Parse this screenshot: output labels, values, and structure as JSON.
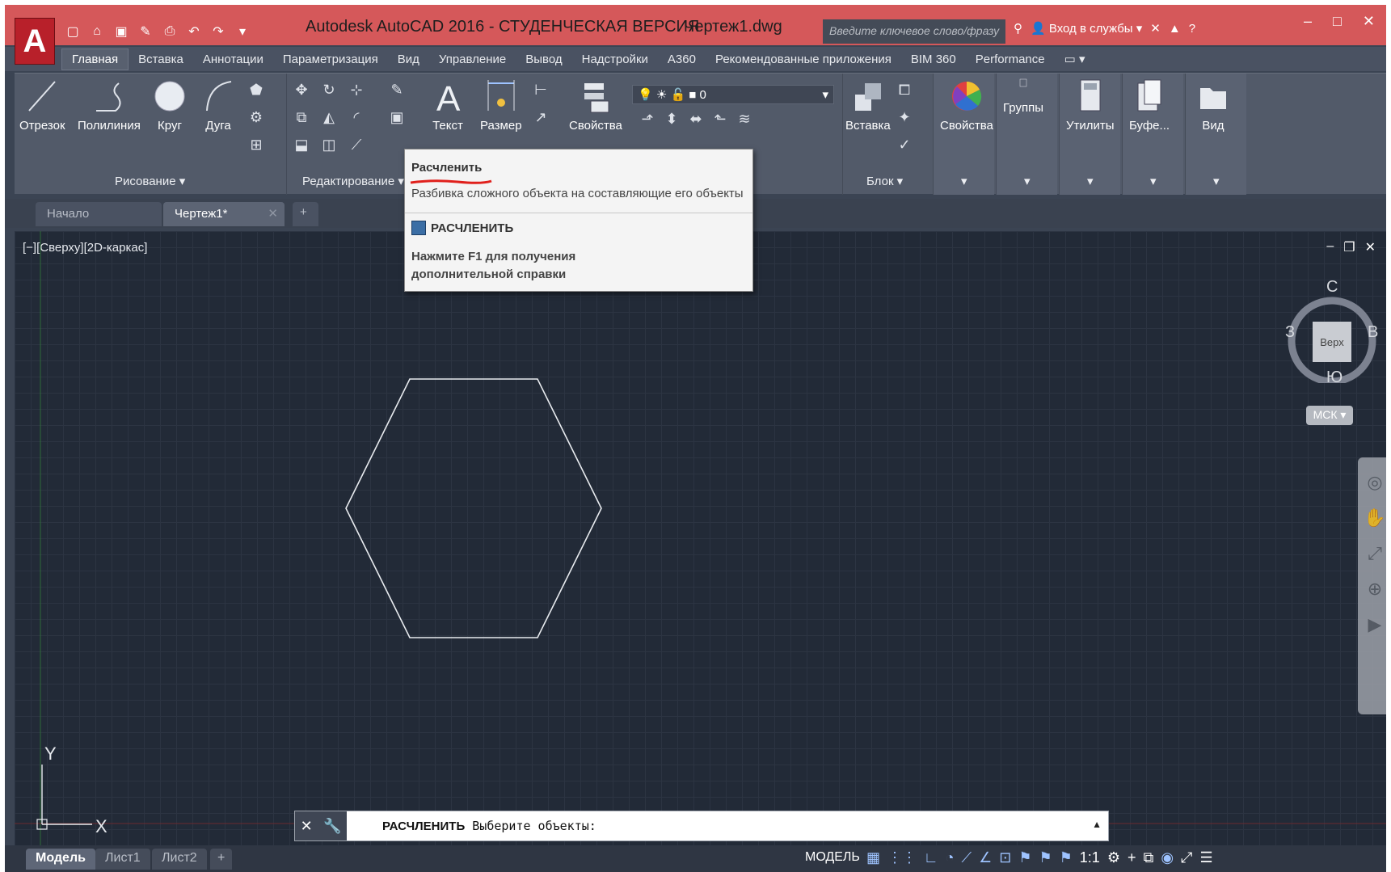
{
  "title": {
    "app": "Autodesk AutoCAD 2016 - СТУДЕНЧЕСКАЯ ВЕРСИЯ",
    "file": "Чертеж1.dwg",
    "search_placeholder": "Введите ключевое слово/фразу",
    "signin": "Вход в службы"
  },
  "ribbon_tabs": [
    "Главная",
    "Вставка",
    "Аннотации",
    "Параметризация",
    "Вид",
    "Управление",
    "Вывод",
    "Надстройки",
    "A360",
    "Рекомендованные приложения",
    "BIM 360",
    "Performance"
  ],
  "draw_tools": [
    "Отрезок",
    "Полилиния",
    "Круг",
    "Дуга"
  ],
  "annotation_tools": [
    "Текст",
    "Размер"
  ],
  "layer_tools": {
    "properties": "Свойства",
    "layer_value": "0"
  },
  "block_tools": {
    "insert": "Вставка"
  },
  "big_buttons": [
    "Свойства",
    "Группы",
    "Утилиты",
    "Буфе...",
    "Вид"
  ],
  "panel_labels": {
    "draw": "Рисование",
    "modify": "Редактирование",
    "block": "Блок"
  },
  "file_tabs": [
    "Начало",
    "Чертеж1*"
  ],
  "viewport_label": "[−][Сверху][2D-каркас]",
  "viewcube": {
    "north": "С",
    "south": "Ю",
    "west": "З",
    "east": "В",
    "face": "Верх",
    "ucs": "МСК"
  },
  "axis": {
    "x": "X",
    "y": "Y"
  },
  "tooltip": {
    "title": "Расчленить",
    "description": "Разбивка сложного объекта на составляющие его объекты",
    "command": "РАСЧЛЕНИТЬ",
    "help_line1": "Нажмите F1 для получения",
    "help_line2": "дополнительной справки"
  },
  "command_line": {
    "command": "РАСЧЛЕНИТЬ",
    "prompt": "Выберите объекты:"
  },
  "layout_tabs": [
    "Модель",
    "Лист1",
    "Лист2"
  ],
  "status": {
    "mode": "МОДЕЛЬ",
    "scale": "1:1"
  },
  "colors": {
    "title_bar": "#d5585a",
    "canvas": "#222a37",
    "app_button": "#b8202a"
  }
}
